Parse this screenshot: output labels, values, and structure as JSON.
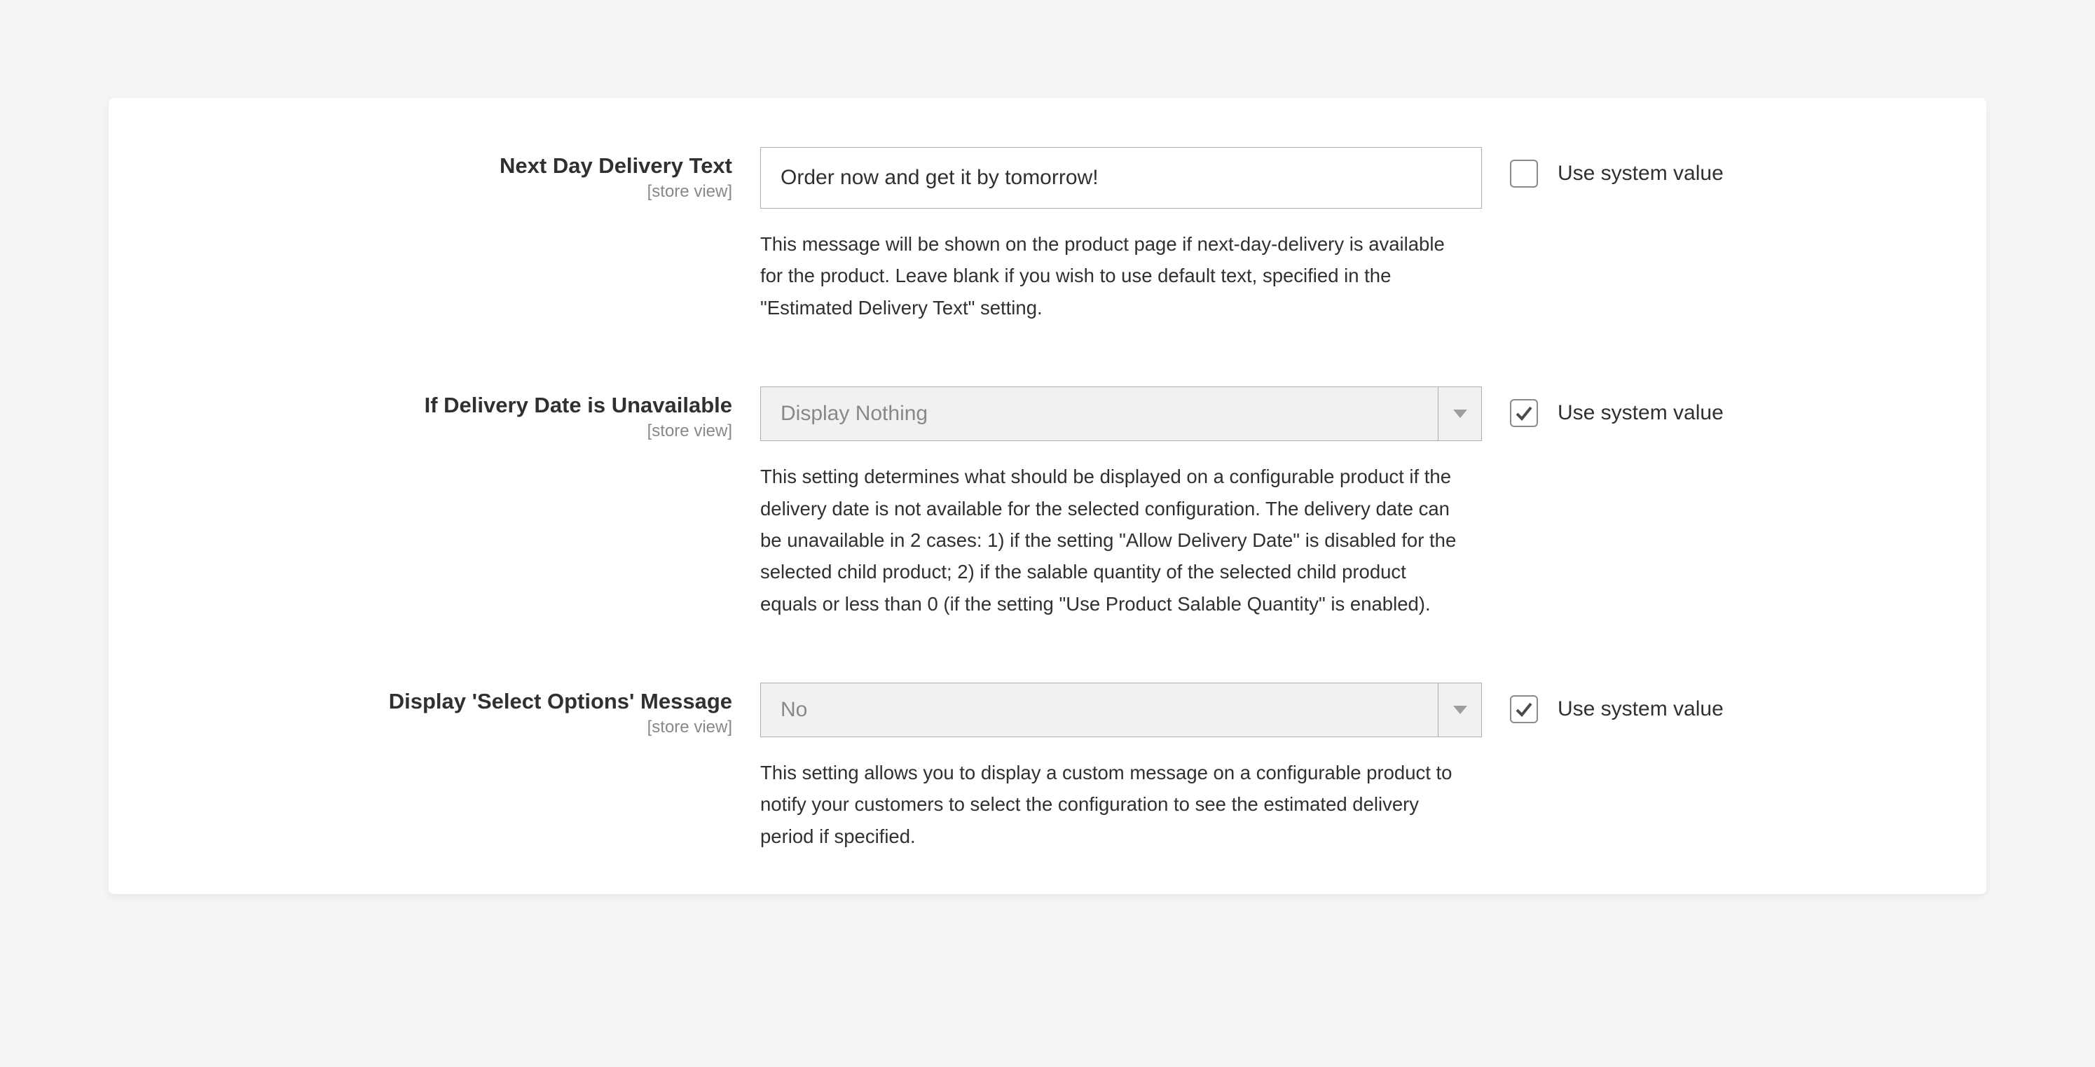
{
  "common": {
    "scope_label": "[store view]",
    "system_value_label": "Use system value"
  },
  "fields": {
    "next_day_delivery": {
      "label": "Next Day Delivery Text",
      "value": "Order now and get it by tomorrow!",
      "help": "This message will be shown on the product page if next-day-delivery is available for the product. Leave blank if you wish to use default text, specified in the \"Estimated Delivery Text\" setting.",
      "use_system": false
    },
    "if_unavailable": {
      "label": "If Delivery Date is Unavailable",
      "value": "Display Nothing",
      "help": "This setting determines what should be displayed on a configurable product if the delivery date is not available for the selected configuration. The delivery date can be unavailable in 2 cases: 1) if the setting \"Allow Delivery Date\" is disabled for the selected child product; 2) if the salable quantity of the selected child product equals or less than 0 (if the setting \"Use Product Salable Quantity\" is enabled).",
      "use_system": true
    },
    "select_options_message": {
      "label": "Display 'Select Options' Message",
      "value": "No",
      "help": "This setting allows you to display a custom message on a configurable product to notify your customers to select the configuration to see the estimated delivery period if specified.",
      "use_system": true
    }
  }
}
